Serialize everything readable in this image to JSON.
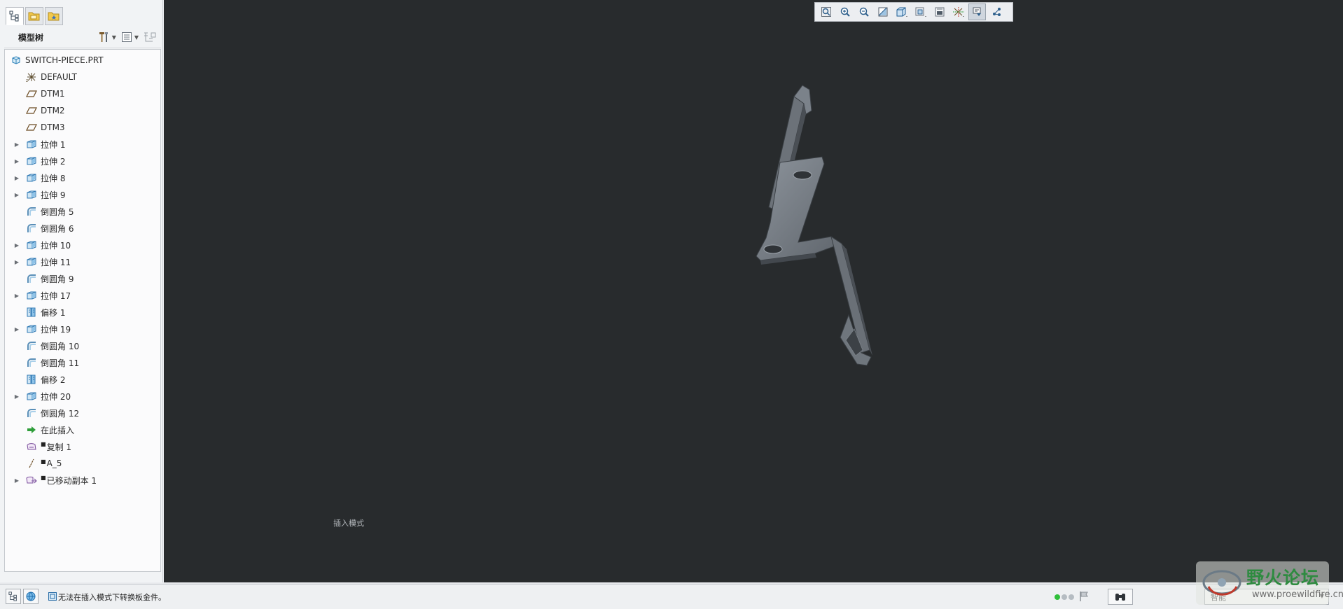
{
  "panel": {
    "tabs": [
      {
        "icon": "model-tree-icon",
        "active": true
      },
      {
        "icon": "folder-browser-icon",
        "active": false
      },
      {
        "icon": "favorites-icon",
        "active": false
      }
    ],
    "tree_title": "模型树",
    "tools": [
      "settings-hammer-icon",
      "show-options-icon",
      "columns-icon"
    ]
  },
  "tree": {
    "root": "SWITCH-PIECE.PRT",
    "items": [
      {
        "label": "DEFAULT",
        "icon": "coordinate-system-icon",
        "expandable": false
      },
      {
        "label": "DTM1",
        "icon": "datum-plane-icon",
        "expandable": false
      },
      {
        "label": "DTM2",
        "icon": "datum-plane-icon",
        "expandable": false
      },
      {
        "label": "DTM3",
        "icon": "datum-plane-icon",
        "expandable": false
      },
      {
        "label": "拉伸 1",
        "icon": "extrude-icon",
        "expandable": true
      },
      {
        "label": "拉伸 2",
        "icon": "extrude-icon",
        "expandable": true
      },
      {
        "label": "拉伸 8",
        "icon": "extrude-icon",
        "expandable": true
      },
      {
        "label": "拉伸 9",
        "icon": "extrude-icon",
        "expandable": true
      },
      {
        "label": "倒圆角 5",
        "icon": "round-icon",
        "expandable": false
      },
      {
        "label": "倒圆角 6",
        "icon": "round-icon",
        "expandable": false
      },
      {
        "label": "拉伸 10",
        "icon": "extrude-icon",
        "expandable": true
      },
      {
        "label": "拉伸 11",
        "icon": "extrude-icon",
        "expandable": true
      },
      {
        "label": "倒圆角 9",
        "icon": "round-icon",
        "expandable": false
      },
      {
        "label": "拉伸 17",
        "icon": "extrude-icon",
        "expandable": true
      },
      {
        "label": "偏移 1",
        "icon": "offset-icon",
        "expandable": false
      },
      {
        "label": "拉伸 19",
        "icon": "extrude-icon",
        "expandable": true
      },
      {
        "label": "倒圆角 10",
        "icon": "round-icon",
        "expandable": false
      },
      {
        "label": "倒圆角 11",
        "icon": "round-icon",
        "expandable": false
      },
      {
        "label": "偏移 2",
        "icon": "offset-icon",
        "expandable": false
      },
      {
        "label": "拉伸 20",
        "icon": "extrude-icon",
        "expandable": true
      },
      {
        "label": "倒圆角 12",
        "icon": "round-icon",
        "expandable": false
      },
      {
        "label": "在此插入",
        "icon": "insert-here-arrow-icon",
        "expandable": false
      },
      {
        "label": "复制 1",
        "icon": "copy-surface-icon",
        "expandable": false,
        "marker": true
      },
      {
        "label": "A_5",
        "icon": "datum-axis-icon",
        "expandable": false,
        "marker": true
      },
      {
        "label": "已移动副本 1",
        "icon": "moved-copy-icon",
        "expandable": true,
        "marker": true
      }
    ]
  },
  "viewport": {
    "mode_label": "插入模式",
    "toolbar": [
      {
        "name": "refit-icon",
        "active": false
      },
      {
        "name": "zoom-in-icon",
        "active": false
      },
      {
        "name": "zoom-out-icon",
        "active": false
      },
      {
        "name": "repaint-icon",
        "active": false
      },
      {
        "name": "display-style-icon",
        "active": false
      },
      {
        "name": "saved-orientations-icon",
        "active": false
      },
      {
        "name": "view-manager-icon",
        "active": false
      },
      {
        "name": "datum-display-icon",
        "active": false
      },
      {
        "name": "annotation-display-icon",
        "active": true
      },
      {
        "name": "spin-center-icon",
        "active": false
      }
    ]
  },
  "status_bar": {
    "message": "无法在插入模式下转换板金件。",
    "filter": "智能",
    "dot_colors": [
      "#2fbf3a",
      "#b5bcc2",
      "#b5bcc2"
    ]
  },
  "watermark": {
    "title": "野火论坛",
    "url": "www.proewildfire.cn"
  }
}
